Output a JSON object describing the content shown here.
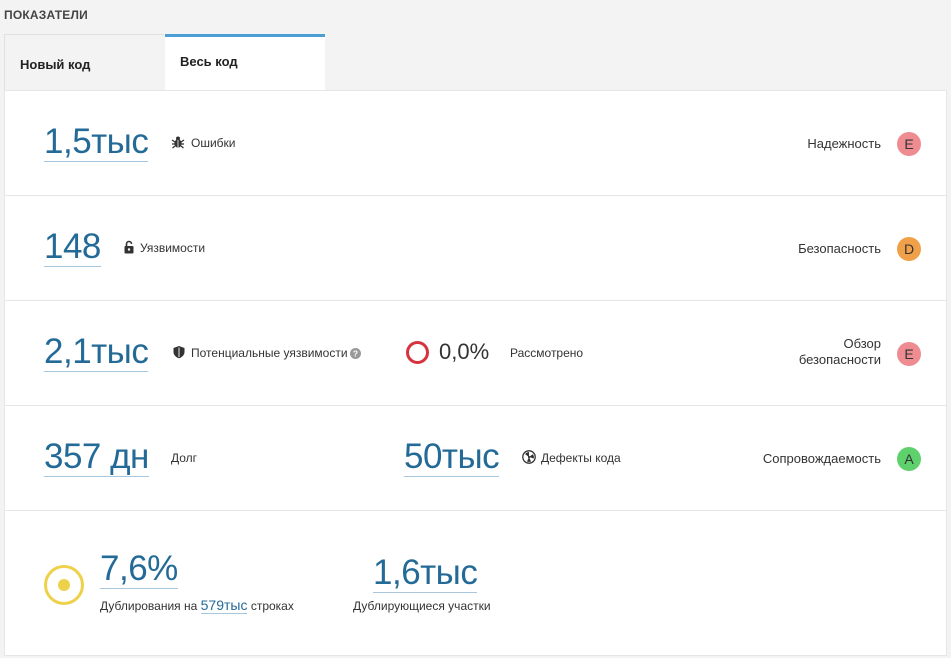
{
  "section_title": "ПОКАЗАТЕЛИ",
  "tabs": [
    {
      "label": "Новый код",
      "active": false
    },
    {
      "label": "Весь код",
      "active": true
    }
  ],
  "colors": {
    "link": "#236a97",
    "rating_E": "#ee8c92",
    "rating_D": "#f1a04a",
    "rating_A": "#5fd16c",
    "tab_active_border": "#4b9fd5",
    "gate_ring": "#d4333f",
    "duplication": "#eed14a"
  },
  "reliability": {
    "value": "1,5тыс",
    "icon": "bug-icon",
    "label": "Ошибки",
    "rating_label": "Надежность",
    "rating": "E"
  },
  "security": {
    "value": "148",
    "icon": "unlock-icon",
    "label": "Уязвимости",
    "rating_label": "Безопасность",
    "rating": "D"
  },
  "security_review": {
    "value": "2,1тыс",
    "icon": "shield-icon",
    "label": "Потенциальные уязвимости",
    "help_icon": "help-icon",
    "reviewed_value": "0,0%",
    "reviewed_label": "Рассмотрено",
    "rating_label_line1": "Обзор",
    "rating_label_line2": "безопасности",
    "rating": "E"
  },
  "maintainability": {
    "debt_value": "357 дн",
    "debt_label": "Долг",
    "smells_value": "50тыс",
    "smells_icon": "code-smell-icon",
    "smells_label": "Дефекты кода",
    "rating_label": "Сопровождаемость",
    "rating": "A"
  },
  "duplications": {
    "percent": "7,6%",
    "desc_prefix": "Дублирования на",
    "lines_value": "579тыс",
    "desc_suffix": "строках",
    "blocks_value": "1,6тыс",
    "blocks_label": "Дублирующиеся участки"
  }
}
